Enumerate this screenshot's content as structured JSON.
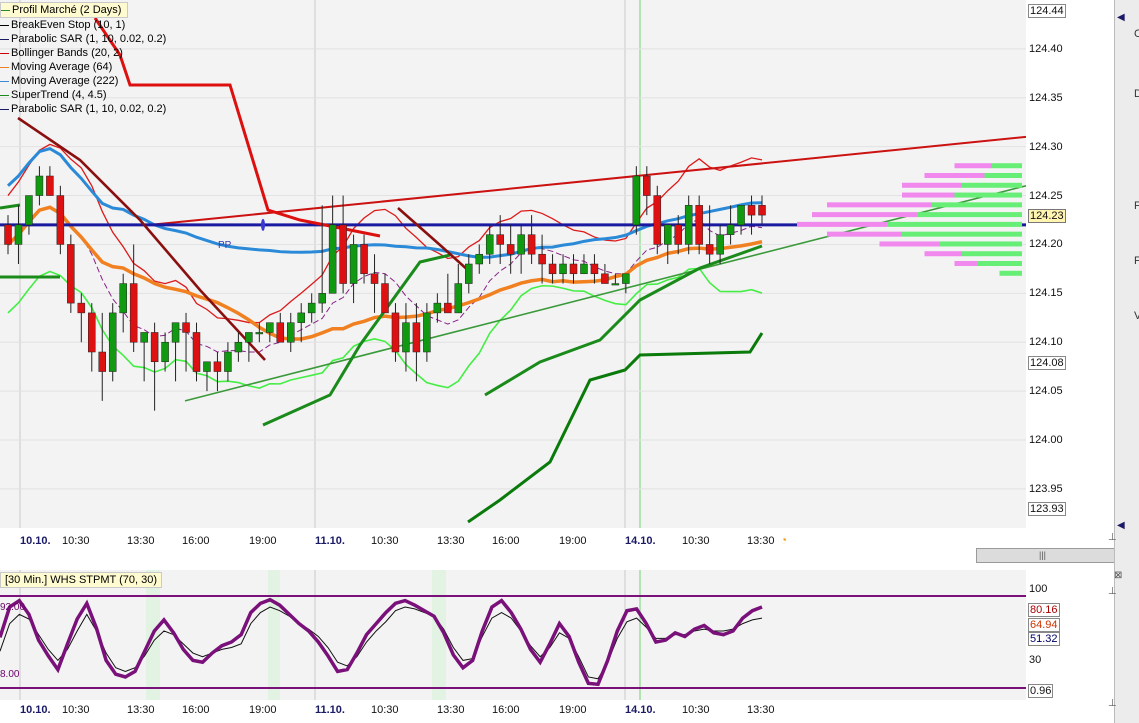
{
  "legend": [
    {
      "label": "Profil Marché (2 Days)",
      "color": "#2a8a2a"
    },
    {
      "label": "BreakEven Stop  (10, 1)",
      "color": "#000000"
    },
    {
      "label": "Parabolic SAR  (1, 10, 0.02, 0.2)",
      "color": "#1a1a66"
    },
    {
      "label": "Bollinger Bands  (20, 2)",
      "color": "#cc0000"
    },
    {
      "label": "Moving Average  (64)",
      "color": "#f08020"
    },
    {
      "label": "Moving Average  (222)",
      "color": "#3a8ad8"
    },
    {
      "label": "SuperTrend  (4, 4.5)",
      "color": "#1a8a1a"
    },
    {
      "label": "Parabolic SAR  (1, 10, 0.02, 0.2)",
      "color": "#1a1a66"
    }
  ],
  "price_axis": {
    "ticks": [
      "124.40",
      "124.35",
      "124.30",
      "124.25",
      "124.20",
      "124.15",
      "124.10",
      "124.05",
      "124.00",
      "123.95"
    ],
    "boxes": {
      "high": "124.44",
      "current": "124.23",
      "mid": "124.08",
      "low": "123.93"
    }
  },
  "pivot_label": "PP",
  "time_axis": {
    "labels": [
      {
        "text": "10.10.",
        "day": true
      },
      {
        "text": "10:30",
        "day": false
      },
      {
        "text": "13:30",
        "day": false
      },
      {
        "text": "16:00",
        "day": false
      },
      {
        "text": "19:00",
        "day": false
      },
      {
        "text": "11.10.",
        "day": true
      },
      {
        "text": "10:30",
        "day": false
      },
      {
        "text": "13:30",
        "day": false
      },
      {
        "text": "16:00",
        "day": false
      },
      {
        "text": "19:00",
        "day": false
      },
      {
        "text": "14.10.",
        "day": true
      },
      {
        "text": "10:30",
        "day": false
      },
      {
        "text": "13:30",
        "day": false
      }
    ]
  },
  "scrollbar": {
    "grip": "|||"
  },
  "oscillator": {
    "title": "[30 Min.] WHS STPMT  (70, 30)",
    "left_top": "92.00",
    "left_bottom": "8.00",
    "axis": {
      "top": "100",
      "mid": "30",
      "v1": "80.16",
      "v2": "64.94",
      "v3": "51.32",
      "bottom": "0.96"
    },
    "colors": {
      "v1": "#aa0000",
      "v2": "#cc3300",
      "v3": "#000066"
    }
  },
  "side_letters": [
    "C",
    "D",
    "F",
    "F",
    "V"
  ],
  "chart_data": {
    "type": "candlestick",
    "title": "",
    "ylim": [
      123.91,
      124.45
    ],
    "line_levels": {
      "pivot": 124.22,
      "current": 124.23
    },
    "candles": [
      {
        "o": 124.22,
        "h": 124.23,
        "l": 124.19,
        "c": 124.2
      },
      {
        "o": 124.2,
        "h": 124.24,
        "l": 124.18,
        "c": 124.22
      },
      {
        "o": 124.22,
        "h": 124.25,
        "l": 124.21,
        "c": 124.25
      },
      {
        "o": 124.25,
        "h": 124.28,
        "l": 124.24,
        "c": 124.27
      },
      {
        "o": 124.27,
        "h": 124.28,
        "l": 124.25,
        "c": 124.25
      },
      {
        "o": 124.25,
        "h": 124.26,
        "l": 124.19,
        "c": 124.2
      },
      {
        "o": 124.2,
        "h": 124.21,
        "l": 124.13,
        "c": 124.14
      },
      {
        "o": 124.14,
        "h": 124.15,
        "l": 124.1,
        "c": 124.13
      },
      {
        "o": 124.13,
        "h": 124.14,
        "l": 124.07,
        "c": 124.09
      },
      {
        "o": 124.09,
        "h": 124.13,
        "l": 124.04,
        "c": 124.07
      },
      {
        "o": 124.07,
        "h": 124.14,
        "l": 124.06,
        "c": 124.13
      },
      {
        "o": 124.13,
        "h": 124.17,
        "l": 124.11,
        "c": 124.16
      },
      {
        "o": 124.16,
        "h": 124.2,
        "l": 124.09,
        "c": 124.1
      },
      {
        "o": 124.1,
        "h": 124.11,
        "l": 124.06,
        "c": 124.11
      },
      {
        "o": 124.11,
        "h": 124.12,
        "l": 124.03,
        "c": 124.08
      },
      {
        "o": 124.08,
        "h": 124.11,
        "l": 124.07,
        "c": 124.1
      },
      {
        "o": 124.1,
        "h": 124.12,
        "l": 124.06,
        "c": 124.12
      },
      {
        "o": 124.12,
        "h": 124.13,
        "l": 124.07,
        "c": 124.11
      },
      {
        "o": 124.11,
        "h": 124.12,
        "l": 124.06,
        "c": 124.07
      },
      {
        "o": 124.07,
        "h": 124.08,
        "l": 124.05,
        "c": 124.08
      },
      {
        "o": 124.08,
        "h": 124.09,
        "l": 124.05,
        "c": 124.07
      },
      {
        "o": 124.07,
        "h": 124.1,
        "l": 124.06,
        "c": 124.09
      },
      {
        "o": 124.09,
        "h": 124.11,
        "l": 124.08,
        "c": 124.1
      },
      {
        "o": 124.1,
        "h": 124.11,
        "l": 124.08,
        "c": 124.11
      },
      {
        "o": 124.11,
        "h": 124.12,
        "l": 124.1,
        "c": 124.11
      },
      {
        "o": 124.11,
        "h": 124.12,
        "l": 124.1,
        "c": 124.12
      },
      {
        "o": 124.12,
        "h": 124.13,
        "l": 124.1,
        "c": 124.1
      },
      {
        "o": 124.1,
        "h": 124.13,
        "l": 124.09,
        "c": 124.12
      },
      {
        "o": 124.12,
        "h": 124.14,
        "l": 124.1,
        "c": 124.13
      },
      {
        "o": 124.13,
        "h": 124.15,
        "l": 124.12,
        "c": 124.14
      },
      {
        "o": 124.14,
        "h": 124.24,
        "l": 124.13,
        "c": 124.15
      },
      {
        "o": 124.15,
        "h": 124.25,
        "l": 124.15,
        "c": 124.22
      },
      {
        "o": 124.22,
        "h": 124.25,
        "l": 124.15,
        "c": 124.16
      },
      {
        "o": 124.16,
        "h": 124.21,
        "l": 124.14,
        "c": 124.2
      },
      {
        "o": 124.2,
        "h": 124.21,
        "l": 124.16,
        "c": 124.17
      },
      {
        "o": 124.17,
        "h": 124.19,
        "l": 124.13,
        "c": 124.16
      },
      {
        "o": 124.16,
        "h": 124.17,
        "l": 124.13,
        "c": 124.13
      },
      {
        "o": 124.13,
        "h": 124.14,
        "l": 124.08,
        "c": 124.09
      },
      {
        "o": 124.09,
        "h": 124.14,
        "l": 124.07,
        "c": 124.12
      },
      {
        "o": 124.12,
        "h": 124.14,
        "l": 124.06,
        "c": 124.09
      },
      {
        "o": 124.09,
        "h": 124.14,
        "l": 124.08,
        "c": 124.13
      },
      {
        "o": 124.13,
        "h": 124.15,
        "l": 124.12,
        "c": 124.14
      },
      {
        "o": 124.14,
        "h": 124.17,
        "l": 124.13,
        "c": 124.13
      },
      {
        "o": 124.13,
        "h": 124.18,
        "l": 124.13,
        "c": 124.16
      },
      {
        "o": 124.16,
        "h": 124.19,
        "l": 124.15,
        "c": 124.18
      },
      {
        "o": 124.18,
        "h": 124.2,
        "l": 124.17,
        "c": 124.19
      },
      {
        "o": 124.19,
        "h": 124.22,
        "l": 124.18,
        "c": 124.21
      },
      {
        "o": 124.21,
        "h": 124.23,
        "l": 124.18,
        "c": 124.2
      },
      {
        "o": 124.2,
        "h": 124.22,
        "l": 124.17,
        "c": 124.19
      },
      {
        "o": 124.19,
        "h": 124.22,
        "l": 124.17,
        "c": 124.21
      },
      {
        "o": 124.21,
        "h": 124.23,
        "l": 124.18,
        "c": 124.19
      },
      {
        "o": 124.19,
        "h": 124.21,
        "l": 124.16,
        "c": 124.18
      },
      {
        "o": 124.18,
        "h": 124.19,
        "l": 124.16,
        "c": 124.17
      },
      {
        "o": 124.17,
        "h": 124.19,
        "l": 124.16,
        "c": 124.18
      },
      {
        "o": 124.18,
        "h": 124.19,
        "l": 124.16,
        "c": 124.17
      },
      {
        "o": 124.17,
        "h": 124.19,
        "l": 124.17,
        "c": 124.18
      },
      {
        "o": 124.18,
        "h": 124.19,
        "l": 124.16,
        "c": 124.17
      },
      {
        "o": 124.17,
        "h": 124.18,
        "l": 124.16,
        "c": 124.16
      },
      {
        "o": 124.16,
        "h": 124.17,
        "l": 124.16,
        "c": 124.16
      },
      {
        "o": 124.16,
        "h": 124.17,
        "l": 124.15,
        "c": 124.17
      },
      {
        "o": 124.22,
        "h": 124.28,
        "l": 124.21,
        "c": 124.27
      },
      {
        "o": 124.27,
        "h": 124.28,
        "l": 124.23,
        "c": 124.25
      },
      {
        "o": 124.25,
        "h": 124.26,
        "l": 124.19,
        "c": 124.2
      },
      {
        "o": 124.2,
        "h": 124.22,
        "l": 124.18,
        "c": 124.22
      },
      {
        "o": 124.22,
        "h": 124.23,
        "l": 124.19,
        "c": 124.2
      },
      {
        "o": 124.2,
        "h": 124.25,
        "l": 124.19,
        "c": 124.24
      },
      {
        "o": 124.24,
        "h": 124.25,
        "l": 124.19,
        "c": 124.2
      },
      {
        "o": 124.2,
        "h": 124.24,
        "l": 124.18,
        "c": 124.19
      },
      {
        "o": 124.19,
        "h": 124.22,
        "l": 124.18,
        "c": 124.21
      },
      {
        "o": 124.21,
        "h": 124.24,
        "l": 124.2,
        "c": 124.22
      },
      {
        "o": 124.22,
        "h": 124.24,
        "l": 124.21,
        "c": 124.24
      },
      {
        "o": 124.24,
        "h": 124.25,
        "l": 124.21,
        "c": 124.23
      },
      {
        "o": 124.24,
        "h": 124.25,
        "l": 124.22,
        "c": 124.23
      }
    ],
    "profile": [
      {
        "price": 124.28,
        "green": 4,
        "pink": 5
      },
      {
        "price": 124.27,
        "green": 5,
        "pink": 8
      },
      {
        "price": 124.26,
        "green": 8,
        "pink": 8
      },
      {
        "price": 124.25,
        "green": 9,
        "pink": 7
      },
      {
        "price": 124.24,
        "green": 12,
        "pink": 14
      },
      {
        "price": 124.23,
        "green": 14,
        "pink": 14
      },
      {
        "price": 124.22,
        "green": 18,
        "pink": 12
      },
      {
        "price": 124.21,
        "green": 16,
        "pink": 10
      },
      {
        "price": 124.2,
        "green": 11,
        "pink": 8
      },
      {
        "price": 124.19,
        "green": 8,
        "pink": 5
      },
      {
        "price": 124.18,
        "green": 6,
        "pink": 3
      },
      {
        "price": 124.17,
        "green": 3,
        "pink": 0
      }
    ],
    "oscillator_series": {
      "ylim": [
        0,
        100
      ],
      "thick": [
        55,
        88,
        95,
        80,
        52,
        35,
        20,
        48,
        75,
        92,
        65,
        30,
        15,
        12,
        18,
        40,
        62,
        74,
        60,
        42,
        30,
        28,
        38,
        46,
        50,
        58,
        82,
        92,
        96,
        90,
        80,
        70,
        62,
        50,
        35,
        18,
        20,
        38,
        58,
        70,
        82,
        92,
        95,
        90,
        84,
        78,
        60,
        36,
        22,
        30,
        62,
        88,
        95,
        82,
        64,
        42,
        28,
        48,
        70,
        56,
        28,
        5,
        4,
        30,
        62,
        84,
        86,
        70,
        50,
        52,
        60,
        56,
        64,
        68,
        60,
        58,
        62,
        76,
        84,
        88
      ],
      "thin": [
        40,
        70,
        80,
        75,
        58,
        42,
        30,
        42,
        62,
        80,
        62,
        38,
        22,
        18,
        22,
        35,
        52,
        62,
        58,
        48,
        38,
        34,
        38,
        42,
        44,
        48,
        70,
        82,
        88,
        84,
        78,
        70,
        64,
        56,
        44,
        28,
        24,
        34,
        50,
        62,
        72,
        84,
        88,
        86,
        82,
        78,
        64,
        44,
        30,
        32,
        56,
        76,
        82,
        76,
        62,
        46,
        34,
        44,
        60,
        54,
        34,
        12,
        10,
        28,
        54,
        72,
        76,
        66,
        54,
        54,
        58,
        58,
        62,
        64,
        62,
        62,
        64,
        70,
        74,
        76
      ]
    }
  }
}
